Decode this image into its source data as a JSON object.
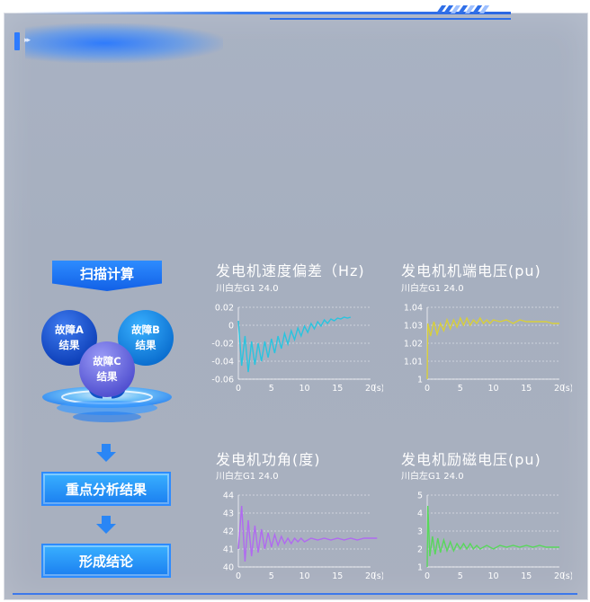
{
  "flow": {
    "scan_label": "扫描计算",
    "fault_a": [
      "故障A",
      "结果"
    ],
    "fault_b": [
      "故障B",
      "结果"
    ],
    "fault_c": [
      "故障C",
      "结果"
    ],
    "step1_label": "重点分析结果",
    "step2_label": "形成结论"
  },
  "colors": {
    "accent": "#2d7bff",
    "panel": "#a9b2c3",
    "speed": "#29c4df",
    "voltage": "#d8cf3a",
    "angle": "#b06af0",
    "excitation": "#58d85b"
  },
  "icons": {
    "header": "chevron-right-icon",
    "arrows": "arrow-down-icon"
  },
  "chart_data": [
    {
      "type": "line",
      "title": "发电机速度偏差（Hz)",
      "subtitle": "川白左G1 24.0",
      "xlabel": "(s)",
      "ylabel": "",
      "xlim": [
        0,
        20
      ],
      "ylim": [
        -0.06,
        0.02
      ],
      "xticks": [
        "0",
        "5",
        "10",
        "15",
        "20"
      ],
      "yticks": [
        "0.02",
        "0",
        "-0.02",
        "-0.04",
        "-0.06"
      ],
      "color": "#29c4df",
      "x": [
        0,
        0.5,
        1,
        1.5,
        2,
        2.5,
        3,
        3.5,
        4,
        4.5,
        5,
        5.5,
        6,
        6.5,
        7,
        7.5,
        8,
        8.5,
        9,
        9.5,
        10,
        10.5,
        11,
        11.5,
        12,
        12.5,
        13,
        13.5,
        14,
        14.5,
        15,
        15.5,
        16,
        16.5,
        17
      ],
      "y": [
        0.005,
        -0.045,
        -0.012,
        -0.052,
        -0.018,
        -0.044,
        -0.02,
        -0.04,
        -0.018,
        -0.036,
        -0.015,
        -0.031,
        -0.012,
        -0.026,
        -0.009,
        -0.021,
        -0.006,
        -0.016,
        -0.003,
        -0.012,
        -0.001,
        -0.008,
        0.002,
        -0.004,
        0.004,
        -0.001,
        0.006,
        0.002,
        0.007,
        0.005,
        0.008,
        0.007,
        0.009,
        0.008,
        0.009
      ],
      "grid": true
    },
    {
      "type": "line",
      "title": "发电机机端电压(pu)",
      "subtitle": "川白左G1 24.0",
      "xlabel": "(s)",
      "ylabel": "",
      "xlim": [
        0,
        20
      ],
      "ylim": [
        1,
        1.04
      ],
      "xticks": [
        "0",
        "5",
        "10",
        "15",
        "20"
      ],
      "yticks": [
        "1.04",
        "1.03",
        "1.02",
        "1.01",
        "1"
      ],
      "color": "#d8cf3a",
      "x": [
        0,
        0.1,
        0.5,
        1,
        1.5,
        2,
        2.5,
        3,
        3.5,
        4,
        4.5,
        5,
        5.5,
        6,
        6.5,
        7,
        7.5,
        8,
        8.5,
        9,
        9.5,
        10,
        11,
        12,
        13,
        14,
        15,
        16,
        17,
        18,
        19,
        20
      ],
      "y": [
        1.0,
        1.031,
        1.024,
        1.032,
        1.025,
        1.031,
        1.027,
        1.033,
        1.028,
        1.033,
        1.029,
        1.034,
        1.03,
        1.034,
        1.03,
        1.033,
        1.031,
        1.034,
        1.031,
        1.033,
        1.031,
        1.033,
        1.032,
        1.033,
        1.031,
        1.033,
        1.032,
        1.032,
        1.032,
        1.032,
        1.031,
        1.031
      ],
      "grid": true
    },
    {
      "type": "line",
      "title": "发电机功角(度)",
      "subtitle": "川白左G1 24.0",
      "xlabel": "(s)",
      "ylabel": "",
      "xlim": [
        0,
        20
      ],
      "ylim": [
        40,
        44
      ],
      "xticks": [
        "0",
        "5",
        "10",
        "15",
        "20"
      ],
      "yticks": [
        "44",
        "43",
        "42",
        "41",
        "40"
      ],
      "color": "#b06af0",
      "x": [
        0,
        0.5,
        1,
        1.5,
        2,
        2.5,
        3,
        3.5,
        4,
        4.5,
        5,
        5.5,
        6,
        6.5,
        7,
        7.5,
        8,
        8.5,
        9,
        9.5,
        10,
        11,
        12,
        13,
        14,
        15,
        16,
        17,
        18,
        19,
        20,
        21
      ],
      "y": [
        41.0,
        43.4,
        40.3,
        42.6,
        40.6,
        42.3,
        40.8,
        42.1,
        41.0,
        41.9,
        41.1,
        41.8,
        41.2,
        41.7,
        41.3,
        41.6,
        41.3,
        41.6,
        41.4,
        41.6,
        41.4,
        41.6,
        41.5,
        41.6,
        41.5,
        41.6,
        41.5,
        41.6,
        41.5,
        41.6,
        41.6,
        41.6
      ],
      "grid": true
    },
    {
      "type": "line",
      "title": "发电机励磁电压(pu)",
      "subtitle": "川白左G1 24.0",
      "xlabel": "(s)",
      "ylabel": "",
      "xlim": [
        0,
        20
      ],
      "ylim": [
        1,
        5
      ],
      "xticks": [
        "0",
        "5",
        "10",
        "15",
        "20"
      ],
      "yticks": [
        "5",
        "4",
        "3",
        "2",
        "1"
      ],
      "color": "#58d85b",
      "x": [
        0,
        0.1,
        0.4,
        0.8,
        1.2,
        1.6,
        2,
        2.5,
        3,
        3.5,
        4,
        4.5,
        5,
        5.5,
        6,
        6.5,
        7,
        7.5,
        8,
        9,
        10,
        11,
        12,
        13,
        14,
        15,
        16,
        17,
        18,
        19,
        20
      ],
      "y": [
        1.0,
        4.4,
        1.6,
        2.7,
        1.7,
        2.6,
        1.8,
        2.5,
        1.9,
        2.4,
        1.9,
        2.3,
        2.0,
        2.3,
        2.0,
        2.3,
        2.0,
        2.2,
        2.0,
        2.2,
        2.0,
        2.2,
        2.1,
        2.2,
        2.1,
        2.2,
        2.1,
        2.2,
        2.1,
        2.1,
        2.1
      ],
      "grid": true
    }
  ]
}
